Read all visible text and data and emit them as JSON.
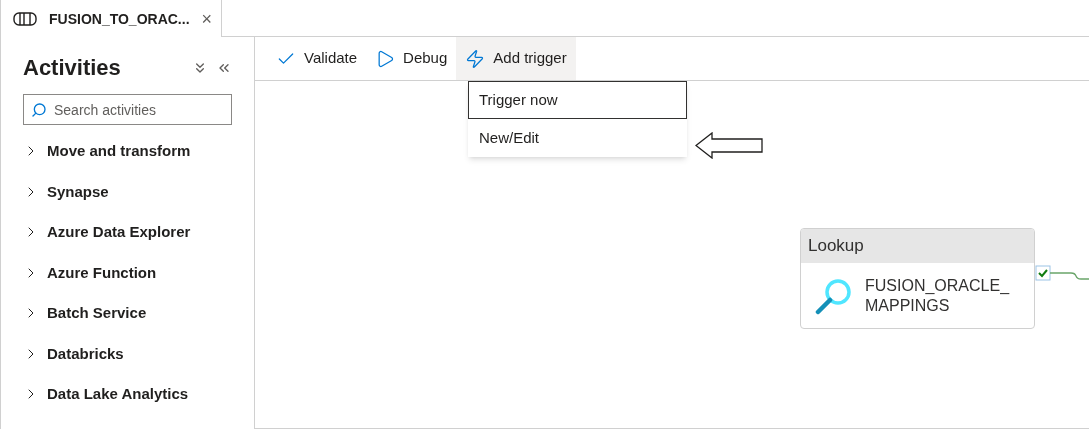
{
  "tab": {
    "title": "FUSION_TO_ORAC...",
    "close": "×"
  },
  "sidebar": {
    "title": "Activities",
    "search": {
      "placeholder": "Search activities"
    },
    "items": [
      {
        "label": "Move and transform",
        "expanded": false
      },
      {
        "label": "Synapse",
        "expanded": false
      },
      {
        "label": "Azure Data Explorer",
        "expanded": false
      },
      {
        "label": "Azure Function",
        "expanded": false
      },
      {
        "label": "Batch Service",
        "expanded": false
      },
      {
        "label": "Databricks",
        "expanded": false
      },
      {
        "label": "Data Lake Analytics",
        "expanded": false
      }
    ]
  },
  "toolbar": {
    "buttons": [
      {
        "kind": "validate",
        "label": "Validate",
        "selected": false
      },
      {
        "kind": "debug",
        "label": "Debug",
        "selected": false
      },
      {
        "kind": "trigger",
        "label": "Add trigger",
        "selected": true
      }
    ]
  },
  "menu": {
    "items": [
      {
        "label": "Trigger now",
        "selected": true
      },
      {
        "label": "New/Edit",
        "selected": false
      }
    ]
  },
  "canvas": {
    "activity": {
      "type": "Lookup",
      "name": "FUSION_ORACLE_\nMAPPINGS",
      "succeeded": true
    }
  }
}
